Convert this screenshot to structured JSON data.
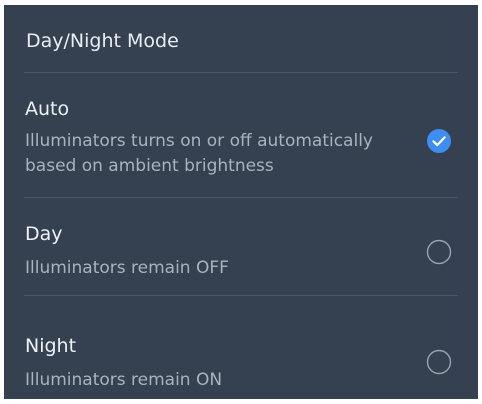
{
  "dialog": {
    "title": "Day/Night Mode"
  },
  "options": [
    {
      "label": "Auto",
      "description": "Illuminators turns on or off automatically based on ambient brightness",
      "selected": true
    },
    {
      "label": "Day",
      "description": "Illuminators remain OFF",
      "selected": false
    },
    {
      "label": "Night",
      "description": "Illuminators remain ON",
      "selected": false
    }
  ],
  "colors": {
    "background": "#354050",
    "accent": "#3d8ef0",
    "divider": "#4c5768",
    "label_text": "#eef1f5",
    "description_text": "#aab2be",
    "radio_outline": "#9aa3b0"
  },
  "icons": {
    "selected": "check-circle-icon",
    "unselected": "radio-empty-icon"
  }
}
